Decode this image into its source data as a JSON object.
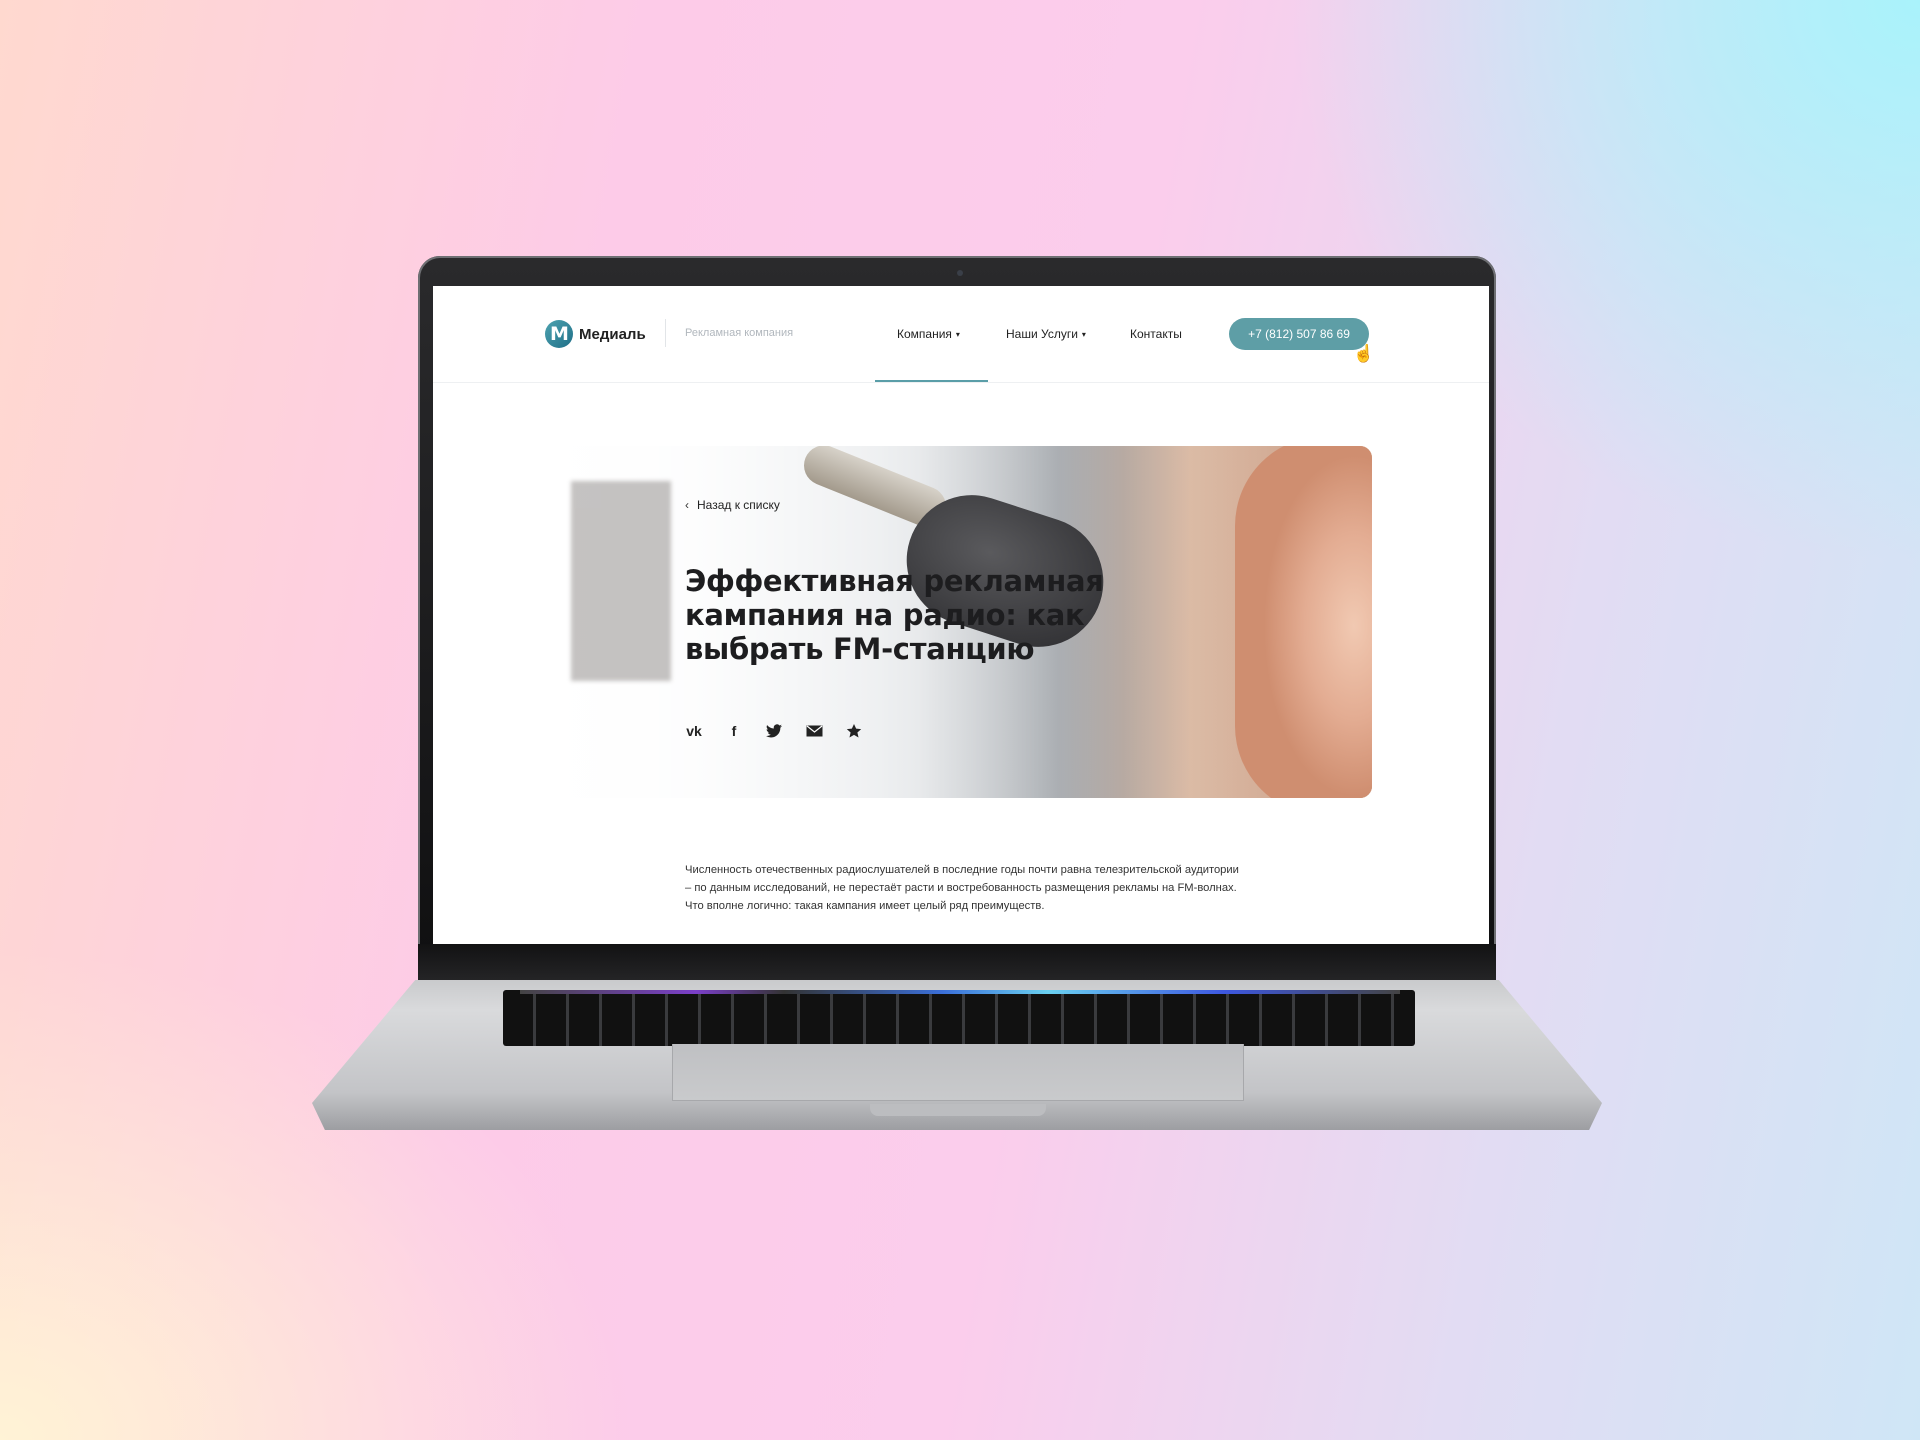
{
  "site": {
    "brand": "Медиаль",
    "tagline": "Рекламная компания",
    "nav": [
      {
        "label": "Компания",
        "has_dropdown": true,
        "active": true
      },
      {
        "label": "Наши Услуги",
        "has_dropdown": true,
        "active": false
      },
      {
        "label": "Контакты",
        "has_dropdown": false,
        "active": false
      }
    ],
    "phone": "+7 (812) 507 86 69",
    "accent_color": "#5e9ea6"
  },
  "hero": {
    "back_link": "Назад к списку",
    "title": "Эффективная рекламная кампания на радио: как выбрать FM-станцию",
    "share_icons": [
      "vk-icon",
      "facebook-icon",
      "twitter-icon",
      "mail-icon",
      "star-icon"
    ]
  },
  "article": {
    "intro": "Численность отечественных радиослушателей в последние годы почти равна телезрительской аудитории – по данным исследований, не перестаёт расти и востребованность размещения рекламы на FM-волнах. Что вполне логично: такая кампания имеет целый ряд преимуществ."
  },
  "icons": {
    "dropdown": "▾",
    "back": "‹",
    "cursor": "☝"
  }
}
